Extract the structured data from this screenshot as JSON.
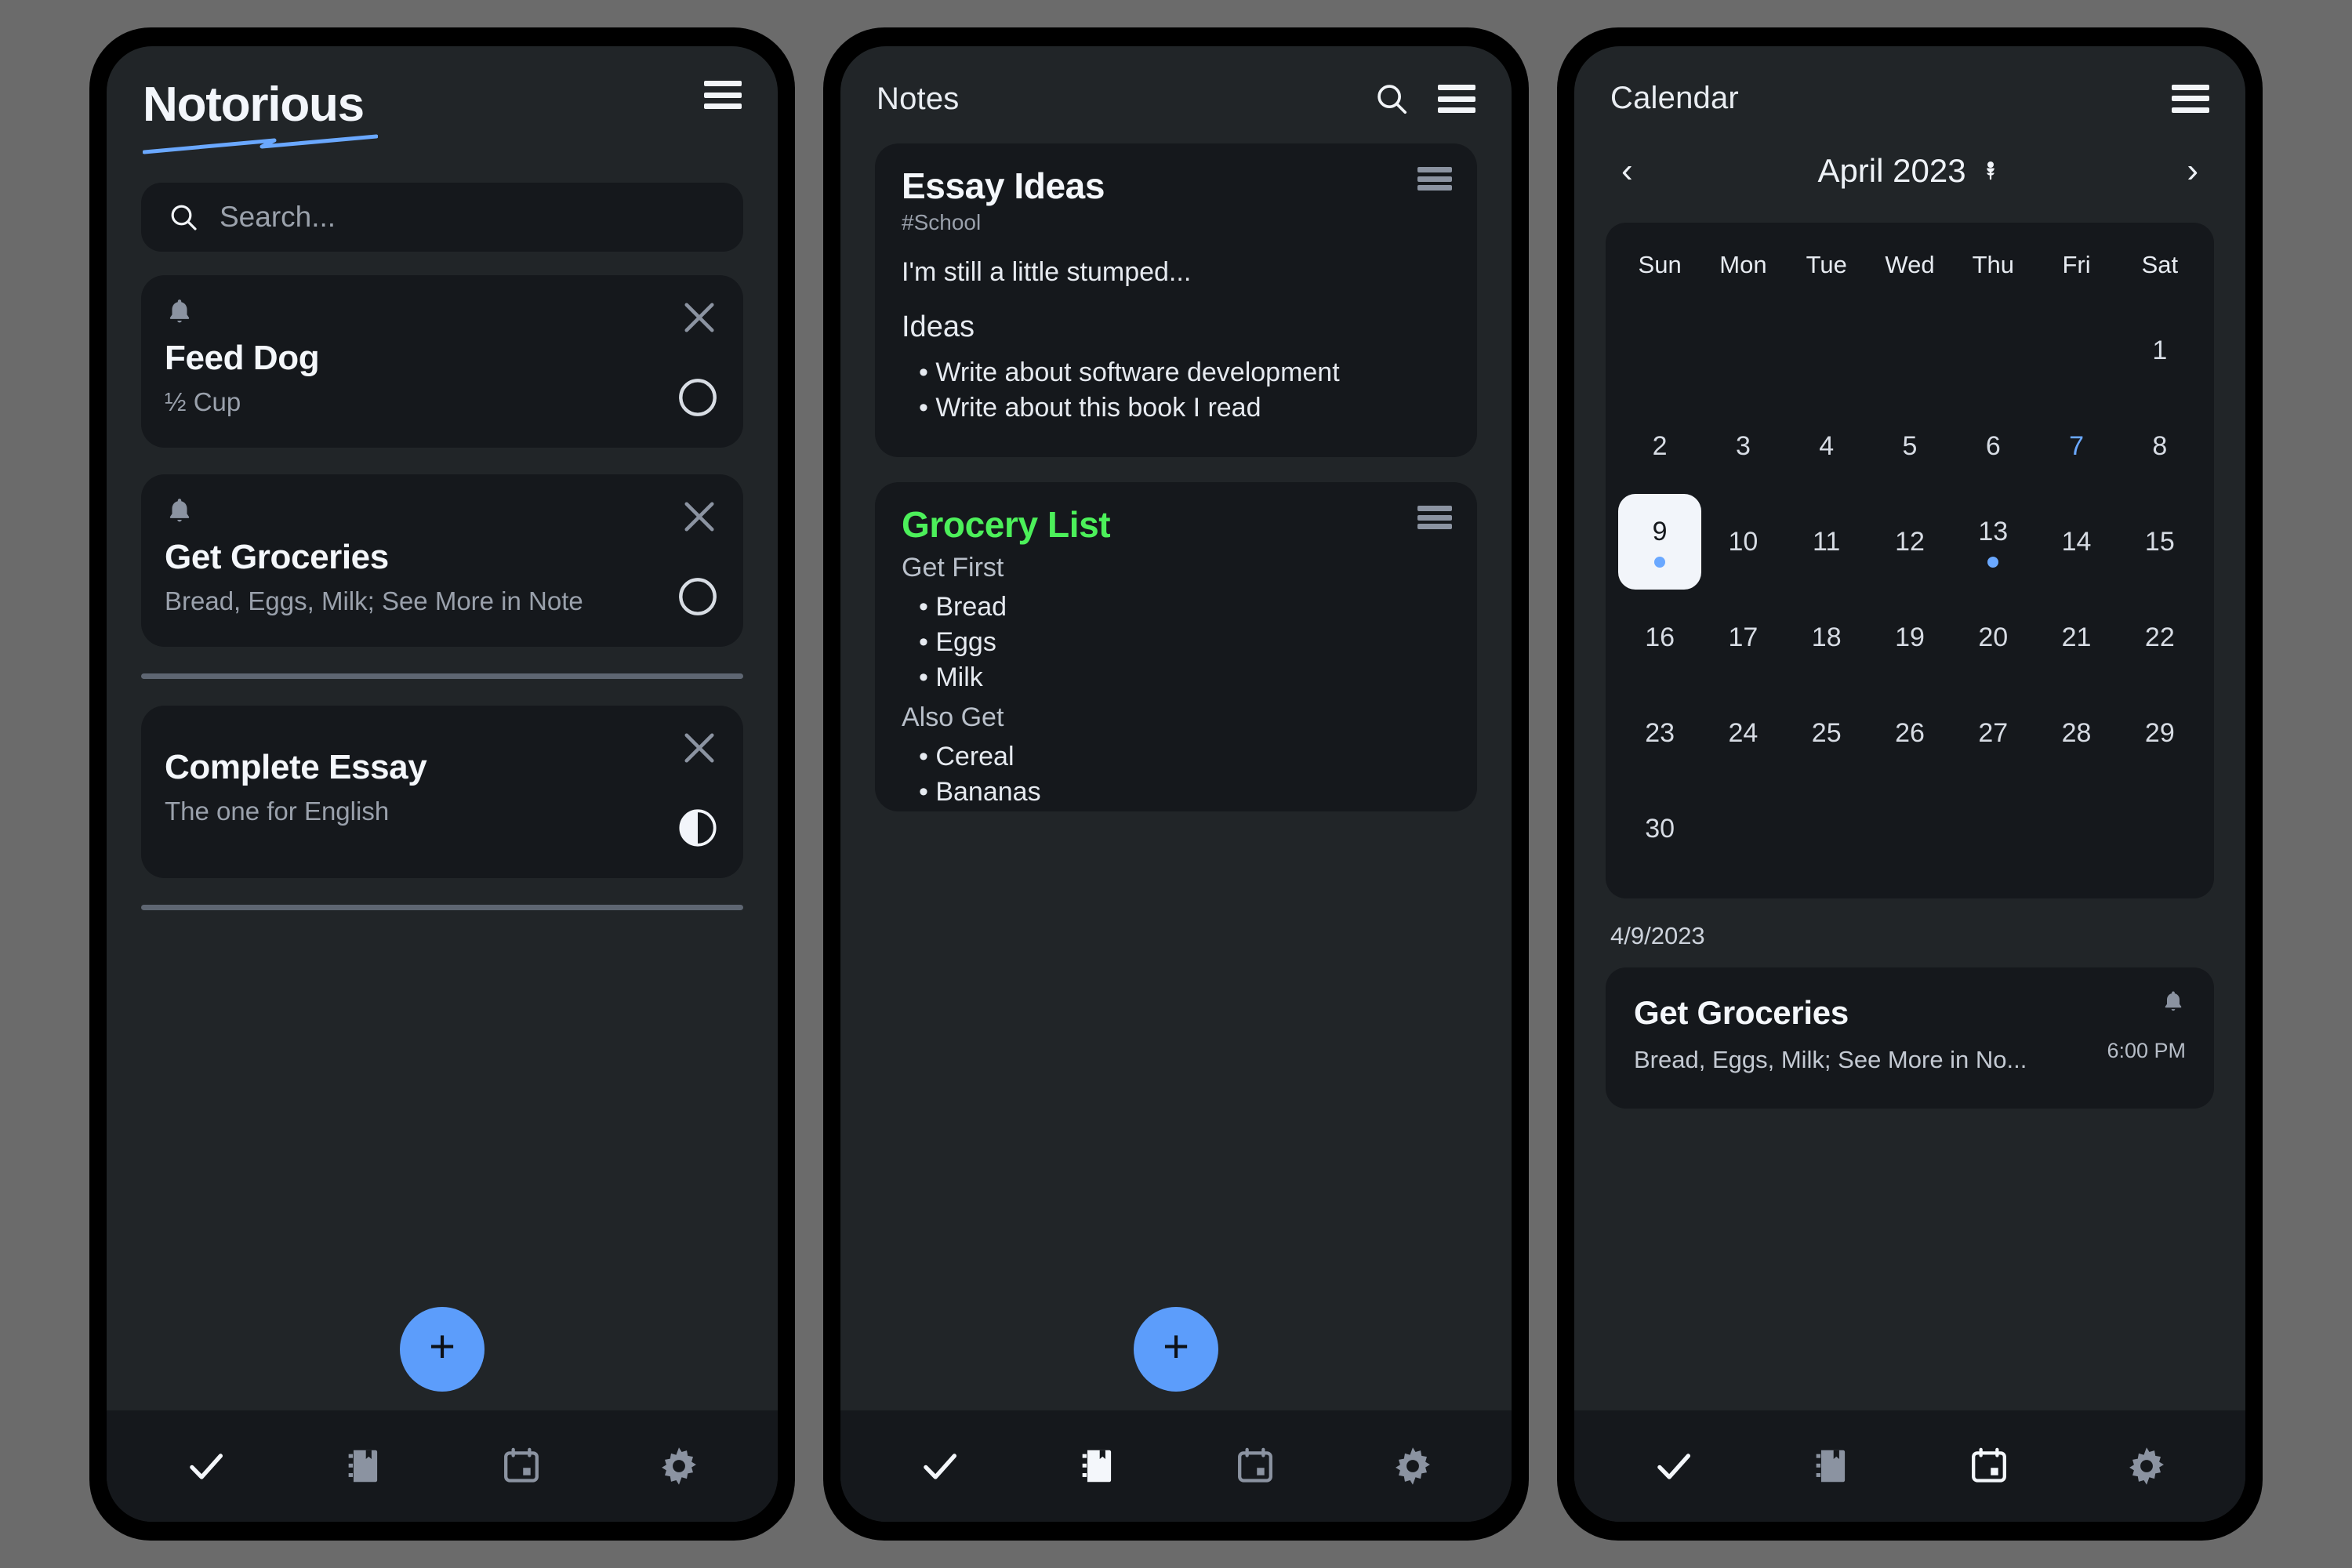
{
  "app": {
    "name": "Notorious",
    "accent": "#5c9dfb",
    "note_accent_green": "#4cf05a"
  },
  "tasks_screen": {
    "logo": "Notorious",
    "menu_icon": "hamburger-icon",
    "search": {
      "placeholder": "Search...",
      "value": "",
      "icon": "search-icon"
    },
    "tasks": [
      {
        "title": "Feed Dog",
        "subtitle": "½ Cup",
        "has_reminder": true,
        "status": "incomplete",
        "status_icon": "circle-empty-icon",
        "close_icon": "close-icon"
      },
      {
        "title": "Get Groceries",
        "subtitle": "Bread, Eggs, Milk; See More in Note",
        "has_reminder": true,
        "status": "incomplete",
        "status_icon": "circle-empty-icon",
        "close_icon": "close-icon"
      },
      {
        "title": "Complete Essay",
        "subtitle": "The one for English",
        "has_reminder": false,
        "status": "in-progress",
        "status_icon": "circle-half-icon",
        "close_icon": "close-icon"
      }
    ],
    "fab_label": "+",
    "nav": [
      {
        "id": "tasks",
        "icon": "check-icon",
        "active": true
      },
      {
        "id": "notes",
        "icon": "notebook-icon",
        "active": false
      },
      {
        "id": "calendar",
        "icon": "calendar-icon",
        "active": false
      },
      {
        "id": "settings",
        "icon": "gear-icon",
        "active": false
      }
    ]
  },
  "notes_screen": {
    "title": "Notes",
    "search_icon": "search-icon",
    "menu_icon": "hamburger-icon",
    "notes": [
      {
        "title": "Essay Ideas",
        "title_color": "#f4f7fb",
        "tag": "#School",
        "body": "I'm still a little stumped...",
        "section": "Ideas",
        "bullets": [
          "• Write about software development",
          "• Write about this book I read"
        ],
        "menu_icon": "drag-handle-icon"
      },
      {
        "title": "Grocery List",
        "title_color": "#4cf05a",
        "section1": "Get First",
        "bullets1": [
          "• Bread",
          "• Eggs",
          "• Milk"
        ],
        "section2": "Also Get",
        "bullets2": [
          "• Cereal",
          "• Bananas"
        ],
        "menu_icon": "drag-handle-icon"
      }
    ],
    "fab_label": "+",
    "nav": [
      {
        "id": "tasks",
        "icon": "check-icon",
        "active": false
      },
      {
        "id": "notes",
        "icon": "notebook-icon",
        "active": true
      },
      {
        "id": "calendar",
        "icon": "calendar-icon",
        "active": false
      },
      {
        "id": "settings",
        "icon": "gear-icon",
        "active": false
      }
    ]
  },
  "calendar_screen": {
    "title": "Calendar",
    "menu_icon": "hamburger-icon",
    "prev_icon": "chevron-left-icon",
    "next_icon": "chevron-right-icon",
    "month_label": "April 2023",
    "month_icon": "flower-icon",
    "day_headers": [
      "Sun",
      "Mon",
      "Tue",
      "Wed",
      "Thu",
      "Fri",
      "Sat"
    ],
    "weeks": [
      [
        {
          "d": ""
        },
        {
          "d": ""
        },
        {
          "d": ""
        },
        {
          "d": ""
        },
        {
          "d": ""
        },
        {
          "d": ""
        },
        {
          "d": "1"
        }
      ],
      [
        {
          "d": "2"
        },
        {
          "d": "3"
        },
        {
          "d": "4"
        },
        {
          "d": "5"
        },
        {
          "d": "6"
        },
        {
          "d": "7",
          "today": true
        },
        {
          "d": "8"
        }
      ],
      [
        {
          "d": "9",
          "selected": true,
          "dot": true
        },
        {
          "d": "10"
        },
        {
          "d": "11"
        },
        {
          "d": "12"
        },
        {
          "d": "13",
          "dot": true
        },
        {
          "d": "14"
        },
        {
          "d": "15"
        }
      ],
      [
        {
          "d": "16"
        },
        {
          "d": "17"
        },
        {
          "d": "18"
        },
        {
          "d": "19"
        },
        {
          "d": "20"
        },
        {
          "d": "21"
        },
        {
          "d": "22"
        }
      ],
      [
        {
          "d": "23"
        },
        {
          "d": "24"
        },
        {
          "d": "25"
        },
        {
          "d": "26"
        },
        {
          "d": "27"
        },
        {
          "d": "28"
        },
        {
          "d": "29"
        }
      ],
      [
        {
          "d": "30"
        },
        {
          "d": ""
        },
        {
          "d": ""
        },
        {
          "d": ""
        },
        {
          "d": ""
        },
        {
          "d": ""
        },
        {
          "d": ""
        }
      ]
    ],
    "selected_date_label": "4/9/2023",
    "events": [
      {
        "title": "Get Groceries",
        "subtitle": "Bread, Eggs, Milk; See More in No...",
        "time": "6:00 PM",
        "has_reminder": true
      }
    ],
    "nav": [
      {
        "id": "tasks",
        "icon": "check-icon",
        "active": false
      },
      {
        "id": "notes",
        "icon": "notebook-icon",
        "active": false
      },
      {
        "id": "calendar",
        "icon": "calendar-icon",
        "active": true
      },
      {
        "id": "settings",
        "icon": "gear-icon",
        "active": false
      }
    ]
  }
}
